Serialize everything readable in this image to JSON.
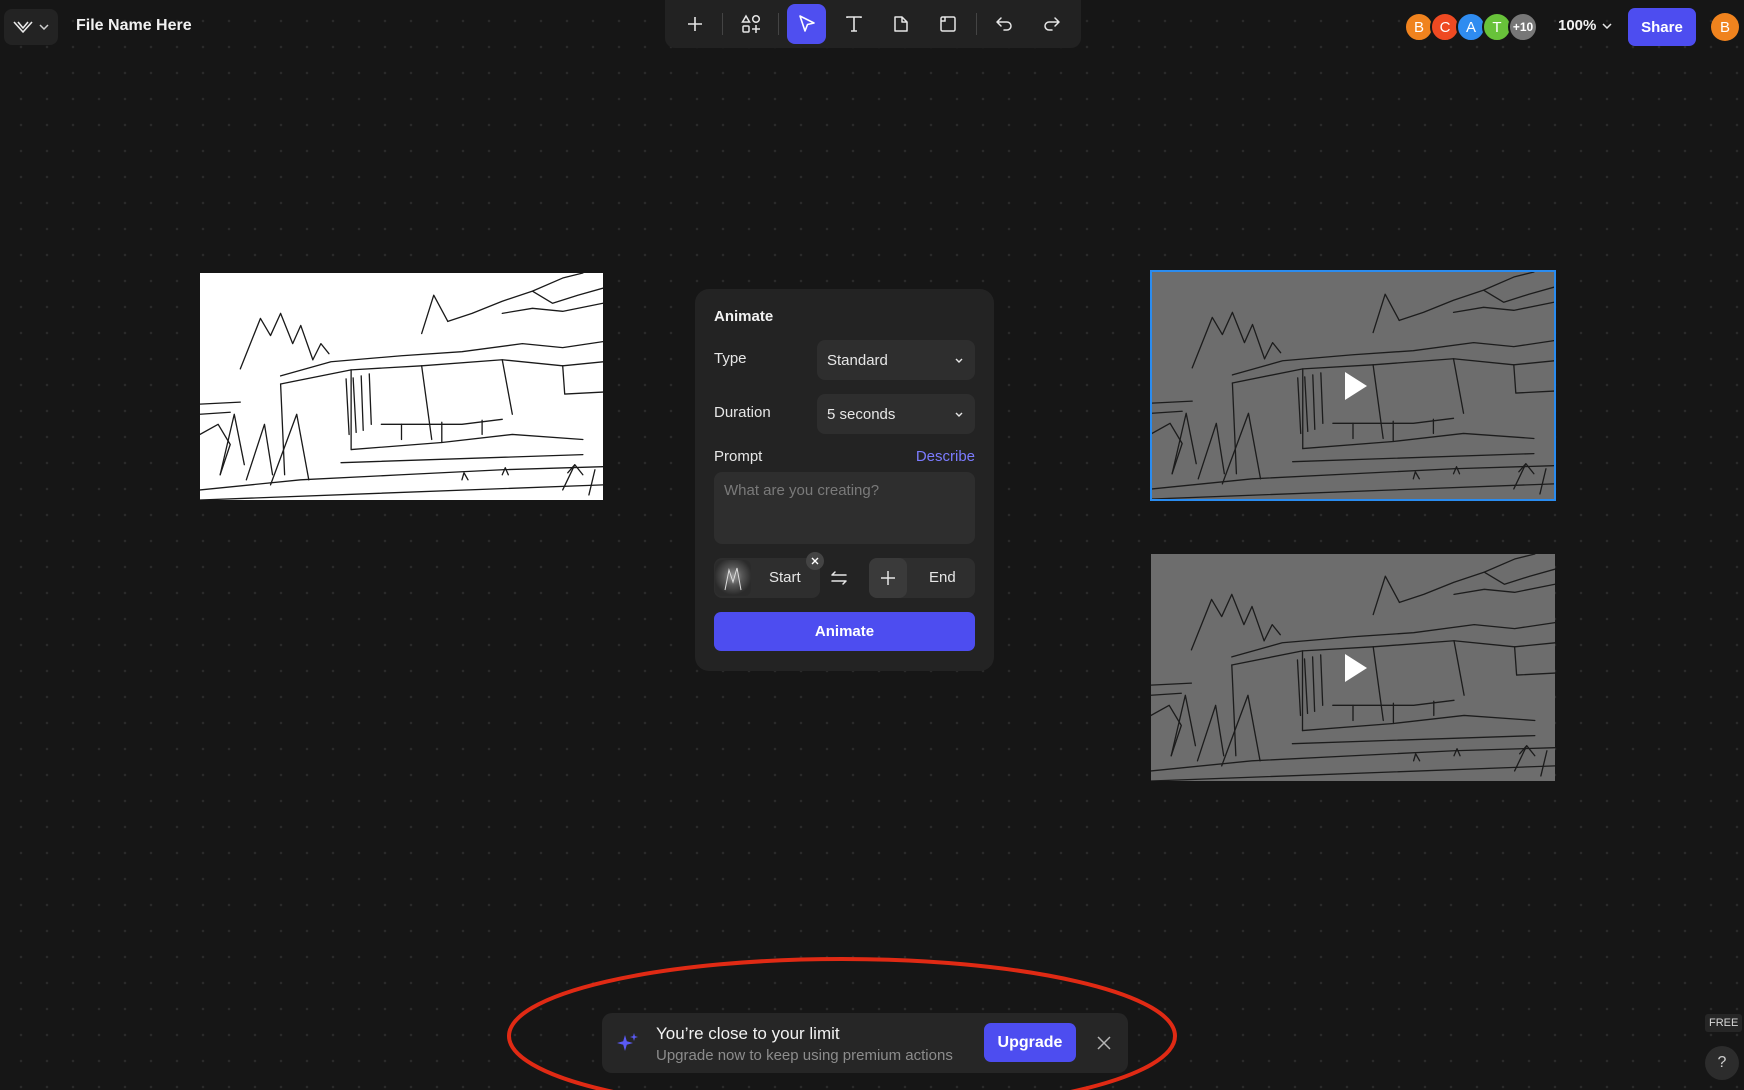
{
  "app": {
    "file_name": "File Name Here",
    "logo_icon": "app-logo-icon"
  },
  "toolbar": {
    "tools": [
      "add-icon",
      "elements-icon",
      "pointer-icon",
      "text-icon",
      "note-icon",
      "frame-icon",
      "undo-icon",
      "redo-icon"
    ],
    "active_tool": "pointer-icon"
  },
  "collaborators": {
    "avatars": [
      {
        "initial": "B",
        "color": "#f0831e"
      },
      {
        "initial": "C",
        "color": "#ef4a22"
      },
      {
        "initial": "A",
        "color": "#2f8cf0"
      },
      {
        "initial": "T",
        "color": "#68c23a"
      }
    ],
    "more_count": "+10"
  },
  "zoom": "100%",
  "share_label": "Share",
  "current_user_initial": "B",
  "animate_panel": {
    "title": "Animate",
    "type_label": "Type",
    "type_value": "Standard",
    "duration_label": "Duration",
    "duration_value": "5 seconds",
    "prompt_label": "Prompt",
    "describe_link": "Describe",
    "prompt_placeholder": "What are you creating?",
    "start_label": "Start",
    "end_label": "End",
    "animate_button": "Animate"
  },
  "toast": {
    "title": "You’re close to your limit",
    "subtitle": "Upgrade now to keep using premium actions",
    "upgrade_label": "Upgrade"
  },
  "plan_badge": "FREE",
  "help_label": "?",
  "colors": {
    "accent": "#4d4df0",
    "selection": "#2a8cf0",
    "annotation": "#e02a14",
    "canvas_bg": "#161616"
  }
}
